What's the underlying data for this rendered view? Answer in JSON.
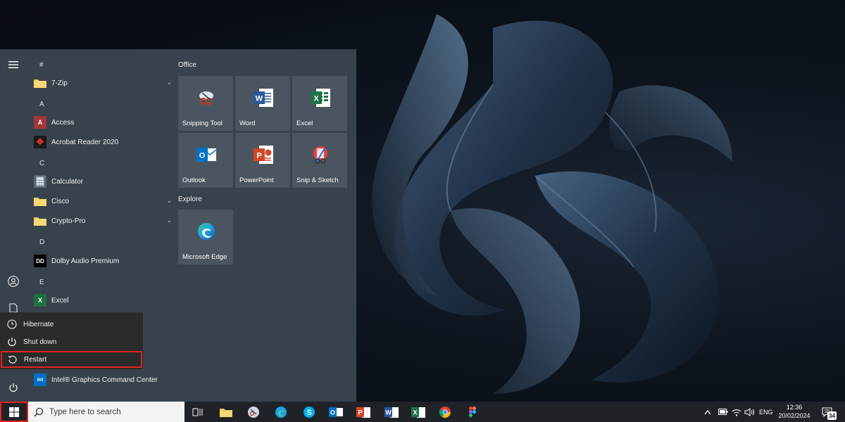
{
  "start_menu": {
    "apps": [
      {
        "type": "letter",
        "label": "#"
      },
      {
        "type": "app",
        "label": "7-Zip",
        "icon": "folder-icon",
        "expandable": true
      },
      {
        "type": "letter",
        "label": "A"
      },
      {
        "type": "app",
        "label": "Access",
        "icon": "access-icon"
      },
      {
        "type": "app",
        "label": "Acrobat Reader 2020",
        "icon": "acrobat-icon"
      },
      {
        "type": "letter",
        "label": "C"
      },
      {
        "type": "app",
        "label": "Calculator",
        "icon": "calculator-icon"
      },
      {
        "type": "app",
        "label": "Cisco",
        "icon": "folder-icon",
        "expandable": true
      },
      {
        "type": "app",
        "label": "Crypto-Pro",
        "icon": "folder-icon",
        "expandable": true
      },
      {
        "type": "letter",
        "label": "D"
      },
      {
        "type": "app",
        "label": "Dolby Audio Premium",
        "icon": "dolby-icon"
      },
      {
        "type": "letter",
        "label": "E"
      },
      {
        "type": "app",
        "label": "Excel",
        "icon": "excel-icon"
      },
      {
        "type": "app",
        "label": "Intel® Graphics Command Center",
        "icon": "intel-icon"
      }
    ],
    "groups": [
      {
        "title": "Office",
        "tiles": [
          "Snipping Tool",
          "Word",
          "Excel",
          "Outlook",
          "PowerPoint",
          "Snip & Sketch"
        ]
      },
      {
        "title": "Explore",
        "tiles": [
          "Microsoft Edge"
        ]
      }
    ],
    "power_menu": {
      "items": [
        {
          "label": "Hibernate",
          "icon": "clock-icon"
        },
        {
          "label": "Shut down",
          "icon": "power-icon"
        },
        {
          "label": "Restart",
          "icon": "restart-icon",
          "highlighted": true
        }
      ]
    }
  },
  "taskbar": {
    "search_placeholder": "Type here to search",
    "language": "ENG",
    "time": "12:36",
    "date": "20/02/2024",
    "notification_count": "34"
  },
  "colors": {
    "start_bg": "#38424c",
    "tile_bg": "#4b555f",
    "highlight": "#e02424",
    "taskbar_bg": "#1f2328"
  }
}
